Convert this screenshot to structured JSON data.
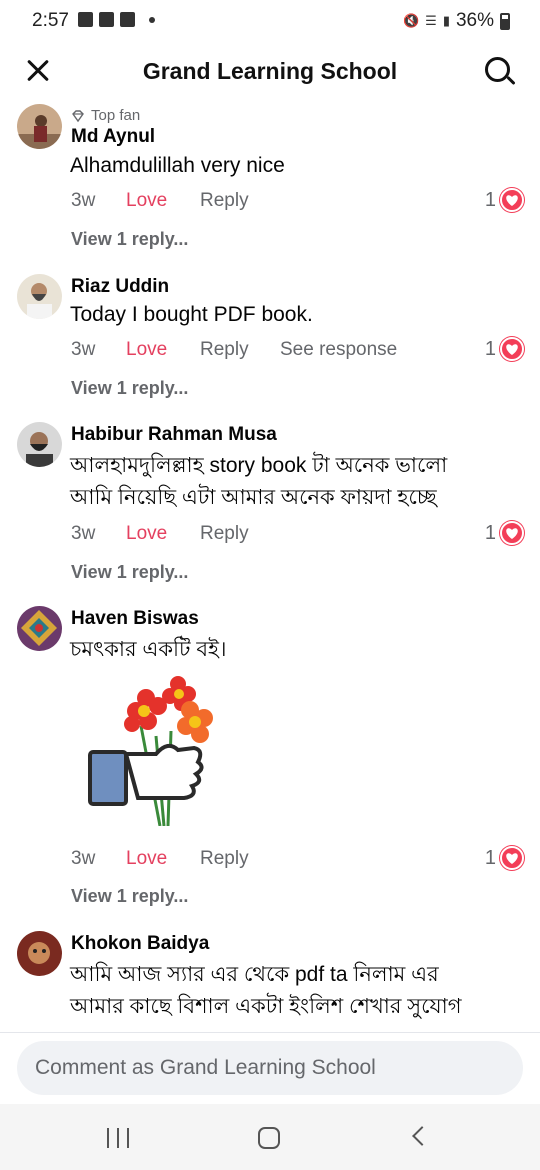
{
  "status": {
    "time": "2:57",
    "battery": "36%"
  },
  "header": {
    "title": "Grand Learning School"
  },
  "comments": [
    {
      "badge": "Top fan",
      "author": "Md Aynul",
      "lines": [
        "Alhamdulillah very nice"
      ],
      "age": "3w",
      "love": "Love",
      "reply": "Reply",
      "reactions": "1",
      "view_replies": "View 1 reply..."
    },
    {
      "author": "Riaz Uddin",
      "lines": [
        "Today I bought PDF book."
      ],
      "age": "3w",
      "love": "Love",
      "reply": "Reply",
      "see_response": "See response",
      "reactions": "1",
      "view_replies": "View 1 reply..."
    },
    {
      "author": "Habibur Rahman Musa",
      "lines": [
        "আলহামদুলিল্লাহ story book টা অনেক ভালো",
        "আমি নিয়েছি এটা আমার অনেক ফায়দা হচ্ছে"
      ],
      "age": "3w",
      "love": "Love",
      "reply": "Reply",
      "reactions": "1",
      "view_replies": "View 1 reply..."
    },
    {
      "author": "Haven Biswas",
      "lines": [
        "চমৎকার একটি বই।"
      ],
      "age": "3w",
      "love": "Love",
      "reply": "Reply",
      "reactions": "1",
      "view_replies": "View 1 reply..."
    },
    {
      "author": "Khokon Baidya",
      "lines": [
        "আমি আজ স্যার এর থেকে pdf ta নিলাম এর",
        "আমার কাছে বিশাল একটা ইংলিশ শেখার সুযোগ"
      ]
    }
  ],
  "composer": {
    "placeholder": "Comment as Grand Learning School"
  },
  "icons": {
    "close": "close-icon",
    "search": "search-icon",
    "heart": "heart-reaction-icon",
    "diamond": "top-fan-diamond-icon"
  },
  "colors": {
    "love": "#e4405f",
    "heart": "#f33e58",
    "secondary_text": "#65676b"
  }
}
